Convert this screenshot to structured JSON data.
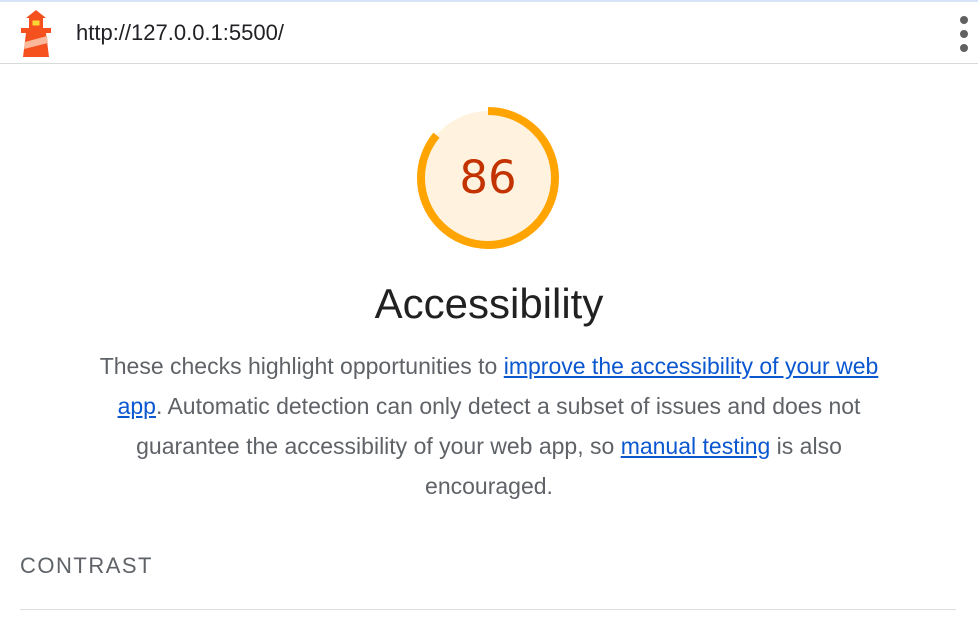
{
  "header": {
    "url": "http://127.0.0.1:5500/"
  },
  "gauge": {
    "score": "86",
    "fraction": 0.86,
    "color": "#ffa400",
    "fill_color": "#fff3e0",
    "score_color": "#c33300"
  },
  "category": {
    "title": "Accessibility",
    "description_part1": "These checks highlight opportunities to ",
    "link1": "improve the accessibility of your web app",
    "description_part2": ". Automatic detection can only detect a subset of issues and does not guarantee the accessibility of your web app, so ",
    "link2": "manual testing",
    "description_part3": " is also encouraged."
  },
  "sections": {
    "contrast_label": "CONTRAST"
  },
  "icons": {
    "logo": "lighthouse-logo-icon",
    "menu": "more-vertical-icon"
  }
}
